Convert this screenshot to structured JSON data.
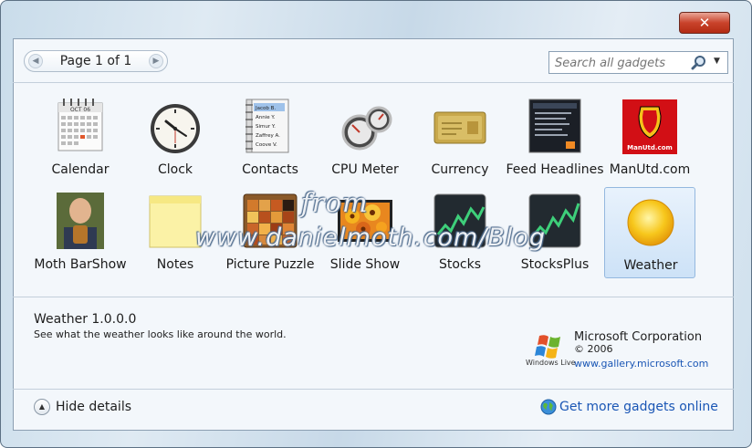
{
  "window": {
    "close_glyph": "✕"
  },
  "pager": {
    "label": "Page 1 of 1",
    "prev_glyph": "◀",
    "next_glyph": "▶"
  },
  "search": {
    "placeholder": "Search all gadgets",
    "icon": "search-icon",
    "dropdown_glyph": "▼"
  },
  "gadgets": [
    {
      "label": "Calendar",
      "icon": "calendar-icon",
      "calendar_month": "OCT 06"
    },
    {
      "label": "Clock",
      "icon": "clock-icon"
    },
    {
      "label": "Contacts",
      "icon": "contacts-icon",
      "contact_names": [
        "Jacob B.",
        "Annie Y.",
        "Simur Y.",
        "Zaffrey A.",
        "Coove V."
      ]
    },
    {
      "label": "CPU Meter",
      "icon": "cpu-meter-icon"
    },
    {
      "label": "Currency",
      "icon": "currency-icon"
    },
    {
      "label": "Feed Headlines",
      "icon": "feed-headlines-icon"
    },
    {
      "label": "ManUtd.com",
      "icon": "manutd-icon",
      "badge_text": "ManUtd.com"
    },
    {
      "label": "Moth BarShow",
      "icon": "moth-photo-icon"
    },
    {
      "label": "Notes",
      "icon": "notes-icon"
    },
    {
      "label": "Picture Puzzle",
      "icon": "picture-puzzle-icon"
    },
    {
      "label": "Slide Show",
      "icon": "slide-show-icon"
    },
    {
      "label": "Stocks",
      "icon": "stocks-icon"
    },
    {
      "label": "StocksPlus",
      "icon": "stocksplus-icon"
    },
    {
      "label": "Weather",
      "icon": "weather-icon",
      "selected": true
    }
  ],
  "details": {
    "title": "Weather 1.0.0.0",
    "description": "See what the weather looks like around the world.",
    "publisher": "Microsoft Corporation",
    "copyright": "© 2006",
    "url": "www.gallery.microsoft.com",
    "logo_text": "Windows Live"
  },
  "footer": {
    "hide_details": "Hide details",
    "hide_glyph": "▲",
    "more_gadgets": "Get more gadgets online"
  },
  "watermark": {
    "line1": "from",
    "line2": "www.danielmoth.com/Blog"
  },
  "colors": {
    "link": "#1a56b5",
    "selection": "#cde2f7",
    "close_button": "#c9432b"
  }
}
